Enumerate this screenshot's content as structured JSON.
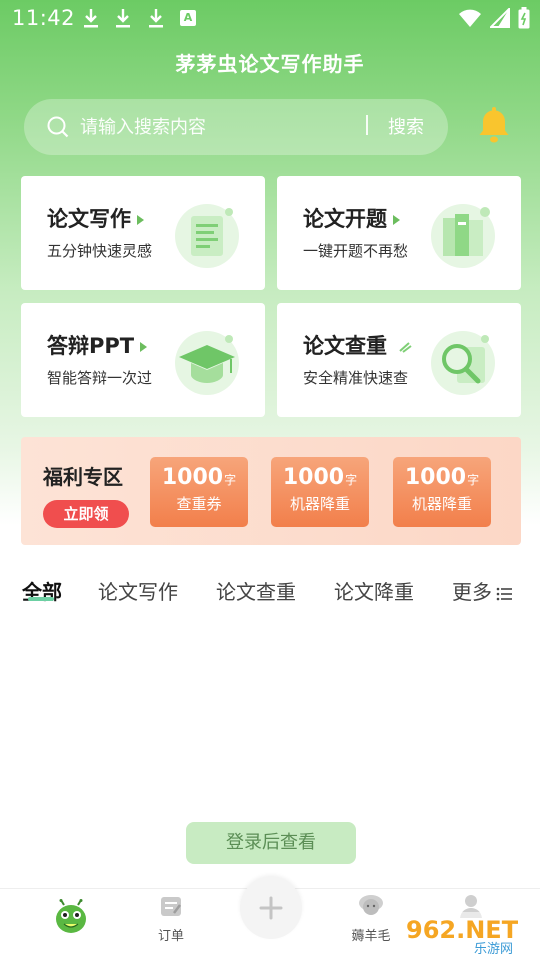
{
  "status_bar": {
    "time": "11:42"
  },
  "header": {
    "title": "茅茅虫论文写作助手"
  },
  "search": {
    "placeholder": "请输入搜索内容",
    "button_label": "搜索"
  },
  "feature_cards": [
    {
      "title": "论文写作",
      "subtitle": "五分钟快速灵感",
      "icon": "document-icon"
    },
    {
      "title": "论文开题",
      "subtitle": "一键开题不再愁",
      "icon": "books-icon"
    },
    {
      "title": "答辩PPT",
      "subtitle": "智能答辩一次过",
      "icon": "graduation-cap-icon"
    },
    {
      "title": "论文查重",
      "subtitle": "安全精准快速查",
      "icon": "magnifier-icon"
    }
  ],
  "welfare": {
    "title": "福利专区",
    "claim_label": "立即领",
    "coupons": [
      {
        "amount": "1000",
        "unit": "字",
        "label": "查重券"
      },
      {
        "amount": "1000",
        "unit": "字",
        "label": "机器降重"
      },
      {
        "amount": "1000",
        "unit": "字",
        "label": "机器降重"
      }
    ]
  },
  "category_tabs": [
    "全部",
    "论文写作",
    "论文查重",
    "论文降重",
    "更多"
  ],
  "login_prompt": "登录后查看",
  "bottom_nav": {
    "order_label": "订单",
    "wool_label": "薅羊毛"
  },
  "watermark": {
    "text": "962.NET",
    "sub": "乐游网"
  },
  "colors": {
    "accent": "#6ccb64",
    "coupon": "#f27f4b",
    "claim": "#f04e4e"
  }
}
